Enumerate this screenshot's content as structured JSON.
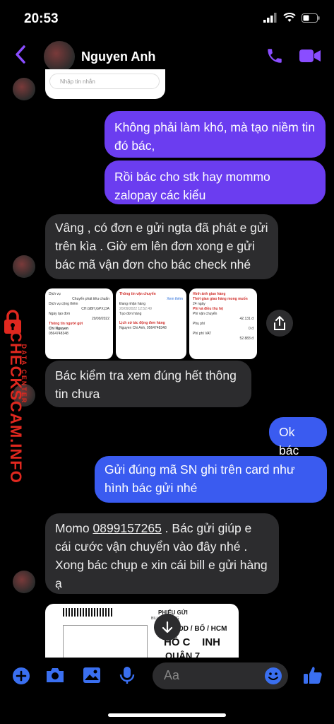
{
  "status": {
    "time": "20:53"
  },
  "header": {
    "contact_name": "Nguyen Anh"
  },
  "top_preview": {
    "placeholder": "Nhập tin nhắn"
  },
  "messages": {
    "m1": "Không phải làm khó, mà tạo niềm tin đó bác,",
    "m2": "Rồi bác cho stk hay mommo zalopay các kiểu",
    "m3": "Vâng , có đơn e gửi ngta đã phát e gửi trên kìa . Giờ em lên đơn xong e gửi bác mã vận đơn cho bác check nhé",
    "m4": "Bác kiểm tra xem đúng hết thông tin chưa",
    "m5": "Ok bác",
    "m6": "Gửi đúng mã SN ghi trên card như hình bác gửi nhé",
    "m7_prefix": "Momo ",
    "m7_phone": "0899157265",
    "m7_suffix": " . Bác gửi giúp e cái cước vận chuyển vào đây nhé . Xong bác chụp e xin cái bill e gửi hàng ạ"
  },
  "screenshots": {
    "a_rows": [
      "Dịch vụ",
      "Chuyển phát tiêu chuẩn",
      "Dịch vụ cộng thêm",
      "CH.GBH,GPX,DA",
      "Ngày tạo đơn",
      "20/09/2022",
      "Thông tin người gửi",
      "Chi Nguyen",
      "0564748348"
    ],
    "b_rows": [
      "Thông tin vận chuyển",
      "Xem thêm",
      "Đang nhận hàng",
      "20/09/2022 12:52:49",
      "Tạo đơn hàng",
      "Lịch sử tác động đơn hàng",
      "Nguyen Chi Anh, 0564748348"
    ],
    "c_rows": [
      "Hình ảnh giao hàng",
      "Thời gian giao hàng mong muốn",
      "24 ngày",
      "Phí và điều thu hộ",
      "Phí vận chuyển",
      "42.131 đ",
      "Phụ phí",
      "0 đ",
      "Phí phí VAT",
      "52.883 đ"
    ],
    "bill_title": "PHIẾU GỬI",
    "bill_sub": "BILL OF CONSIG",
    "bill_code": "OD / BỐ / HCM",
    "bill_city": "HỒ C    INH",
    "bill_district": "QUẬN 7"
  },
  "watermark": {
    "brand": "CHECKSCAM.INFO",
    "tag": "DATA CENTER"
  },
  "composer": {
    "placeholder": "Aa"
  },
  "colors": {
    "accent": "#8a4dff",
    "sent_bubble": "#6b3df0",
    "sent_blue": "#3a5bf0",
    "recv_bubble": "#2c2c2e",
    "watermark_red": "#e0281f"
  }
}
